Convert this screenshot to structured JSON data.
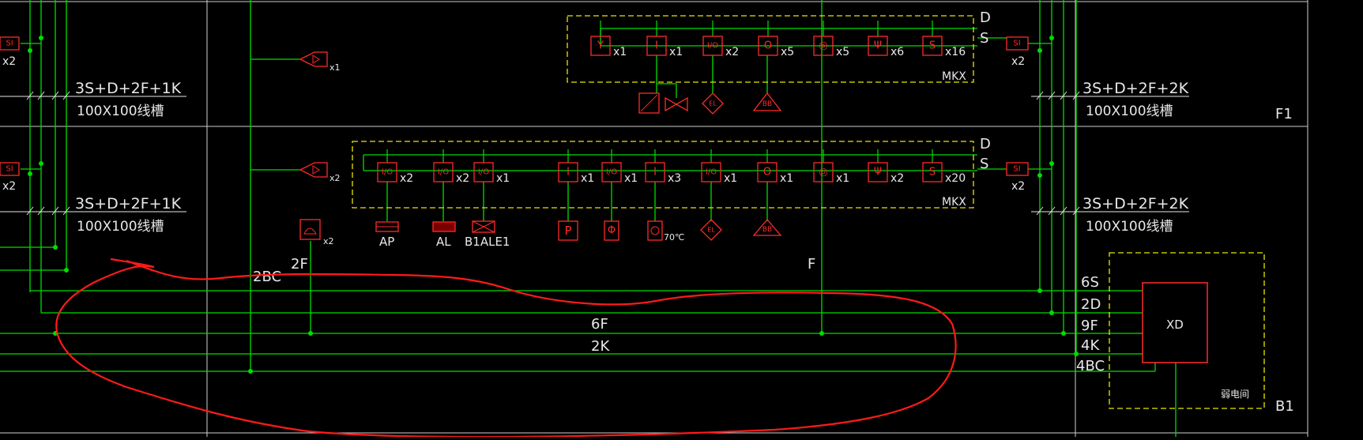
{
  "colors": {
    "background": "#000000",
    "wire": "#00dd00",
    "device": "#ff2a2a",
    "frame": "#e6e600",
    "text": "#e8e8e8",
    "grid": "#cfcfcf",
    "markup": "#ff1a1a"
  },
  "floors": {
    "f1": "F1",
    "b1": "B1"
  },
  "left_panel": {
    "si_label": "SI",
    "qty_upper": "x2",
    "qty_lower": "x2",
    "cable_upper": "3S+D+2F+1K",
    "tray_upper": "100X100线槽",
    "cable_lower": "3S+D+2F+1K",
    "tray_lower": "100X100线槽"
  },
  "right_panel": {
    "si_label": "SI",
    "qty_upper": "x2",
    "qty_lower": "x2",
    "cable_upper": "3S+D+2F+2K",
    "tray_upper": "100X100线槽",
    "cable_lower": "3S+D+2F+2K",
    "tray_lower": "100X100线槽"
  },
  "speakers": [
    {
      "icon": "speaker-icon",
      "qty": "x1"
    },
    {
      "icon": "speaker-icon",
      "qty": "x2"
    }
  ],
  "mkx_upper": {
    "label": "MKX",
    "d_label": "D",
    "s_label": "S",
    "devices": [
      {
        "icon": "smoke-detector-icon",
        "glyph": "Y",
        "qty": "x1"
      },
      {
        "icon": "input-module-icon",
        "glyph": "I",
        "qty": "x1"
      },
      {
        "icon": "io-module-icon",
        "glyph": "I/O",
        "qty": "x2"
      },
      {
        "icon": "output-module-icon",
        "glyph": "O",
        "qty": "x5"
      },
      {
        "icon": "manual-alarm-icon",
        "glyph": "◎",
        "qty": "x5"
      },
      {
        "icon": "heat-detector-icon",
        "glyph": "Ψ",
        "qty": "x6"
      },
      {
        "icon": "smoke-detector-icon",
        "glyph": "S",
        "qty": "x16"
      }
    ],
    "sub_devices": [
      {
        "icon": "fire-damper-icon",
        "label": ""
      },
      {
        "icon": "valve-icon",
        "label": ""
      },
      {
        "icon": "emergency-light-icon",
        "label": "EL"
      },
      {
        "icon": "alarm-bell-icon",
        "label": "BB"
      }
    ]
  },
  "mkx_lower": {
    "label": "MKX",
    "d_label": "D",
    "s_label": "S",
    "devices": [
      {
        "icon": "io-module-icon",
        "glyph": "I/O",
        "qty": "x2"
      },
      {
        "icon": "io-module-icon",
        "glyph": "I/O",
        "qty": "x2"
      },
      {
        "icon": "io-module-icon",
        "glyph": "I/O",
        "qty": "x1"
      },
      {
        "icon": "input-module-icon",
        "glyph": "I",
        "qty": "x1"
      },
      {
        "icon": "io-module-icon",
        "glyph": "I/O",
        "qty": "x1"
      },
      {
        "icon": "input-module-icon",
        "glyph": "I",
        "qty": "x3"
      },
      {
        "icon": "io-module-icon",
        "glyph": "I/O",
        "qty": "x1"
      },
      {
        "icon": "output-module-icon",
        "glyph": "O",
        "qty": "x1"
      },
      {
        "icon": "manual-alarm-icon",
        "glyph": "◎",
        "qty": "x1"
      },
      {
        "icon": "heat-detector-icon",
        "glyph": "Ψ",
        "qty": "x2"
      },
      {
        "icon": "smoke-detector-icon",
        "glyph": "S",
        "qty": "x20"
      }
    ],
    "sub_devices": [
      {
        "icon": "power-panel-icon",
        "label": "AP"
      },
      {
        "icon": "lighting-panel-icon",
        "label": "AL"
      },
      {
        "icon": "lamp-box-icon",
        "label": "B1ALE1"
      },
      {
        "icon": "pressure-switch-icon",
        "label": "P"
      },
      {
        "icon": "flow-switch-icon",
        "label": "Φ"
      },
      {
        "icon": "fire-damper-70-icon",
        "label": "70℃"
      },
      {
        "icon": "emergency-light-icon",
        "label": "EL"
      },
      {
        "icon": "alarm-bell-icon",
        "label": "BB"
      }
    ]
  },
  "phone": {
    "icon": "telephone-icon",
    "qty": "x2"
  },
  "bus_labels": {
    "bc2": "2BC",
    "f2": "2F",
    "f": "F",
    "f6": "6F",
    "k2": "2K",
    "s6": "6S",
    "d2": "2D",
    "f9": "9F",
    "k4": "4K",
    "bc4": "4BC"
  },
  "xd": {
    "label": "XD",
    "room_label": "弱电间"
  }
}
